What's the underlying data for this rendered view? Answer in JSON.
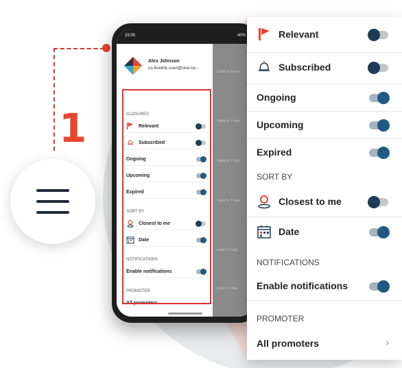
{
  "step": {
    "number": "1"
  },
  "phone": {
    "status_time": "15:05",
    "status_battery": "40%",
    "behind_texts": [
      "Starts in 6 hour",
      "Starts in 7 hour",
      "Starts in 7 hour",
      "Starts in 7 hour",
      "Ends in 7 day",
      "Ends in 8 day"
    ],
    "behind_letters": [
      "r",
      "e,",
      "tia",
      "r"
    ]
  },
  "profile": {
    "name": "Alex Johnson",
    "email": "us.livelink.user@one.ne..."
  },
  "closures": {
    "section_label": "CLOSURES",
    "items": [
      {
        "label": "Relevant",
        "icon": "flag-icon",
        "on": false
      },
      {
        "label": "Subscribed",
        "icon": "bell-icon",
        "on": false
      },
      {
        "label": "Ongoing",
        "on": true
      },
      {
        "label": "Upcoming",
        "on": true
      },
      {
        "label": "Expired",
        "on": true
      }
    ]
  },
  "sort": {
    "section_label": "SORT BY",
    "items": [
      {
        "label": "Closest to me",
        "icon": "location-pin-icon",
        "on": false
      },
      {
        "label": "Date",
        "icon": "calendar-icon",
        "on": true
      }
    ]
  },
  "notifications": {
    "section_label": "NOTIFICATIONS",
    "items": [
      {
        "label": "Enable notifications",
        "on": true
      }
    ]
  },
  "promoter": {
    "section_label": "PROMOTER",
    "all_label": "All promoters",
    "chevron": "›"
  },
  "colors": {
    "accent": "#e6462f",
    "toggle_knob": "#1f5a82"
  }
}
